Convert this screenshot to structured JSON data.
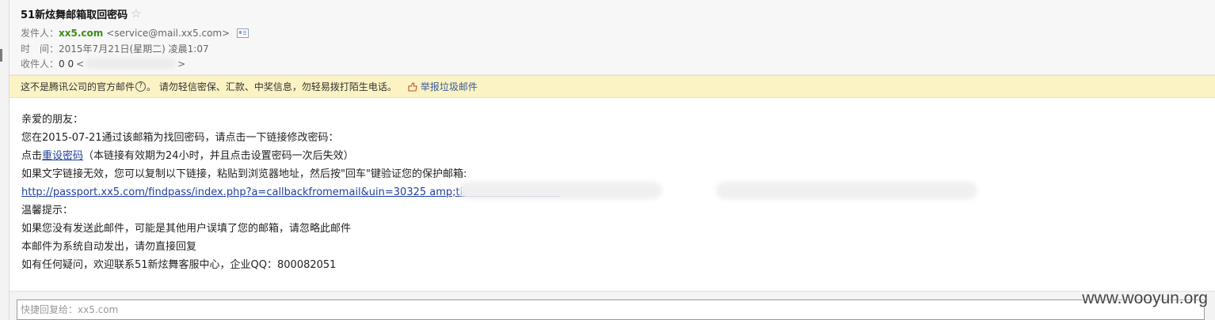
{
  "header": {
    "subject": "51新炫舞邮箱取回密码",
    "star": "☆",
    "from_label": "发件人：",
    "from_name": "xx5.com",
    "from_address": "<service@mail.xx5.com>",
    "time_label": "时　间：",
    "time_value": "2015年7月21日(星期二) 凌晨1:07",
    "to_label": "收件人：",
    "to_name": "0 0",
    "to_open": "<",
    "to_close": ">"
  },
  "notice": {
    "text_before": "这不是腾讯公司的官方邮件",
    "question_mark": "?",
    "text_after": "。 请勿轻信密保、汇款、中奖信息，勿轻易拨打陌生电话。",
    "report_label": "举报垃圾邮件"
  },
  "body": {
    "greeting": "亲爱的朋友：",
    "line1": "您在2015-07-21通过该邮箱为找回密码，请点击一下链接修改密码：",
    "line2_prefix": "点击",
    "line2_link": "重设密码",
    "line2_suffix": "（本链接有效期为24小时，并且点击设置密码一次后失效）",
    "line3": "如果文字链接无效，您可以复制以下链接，粘贴到浏览器地址，然后按\"回车\"键验证您的保护邮箱:",
    "url": "http://passport.xx5.com/findpass/index.php?a=callbackfromemail&uin=30325                              amp;time                                                          577d46e12ecd",
    "tips_title": "温馨提示：",
    "tip1": "如果您没有发送此邮件，可能是其他用户误填了您的邮箱，请忽略此邮件",
    "tip2": "本邮件为系统自动发出，请勿直接回复",
    "tip3": "如有任何疑问，欢迎联系51新炫舞客服中心，企业QQ：800082051"
  },
  "reply": {
    "placeholder": "快捷回复给：xx5.com"
  },
  "watermark": "www.wooyun.org"
}
